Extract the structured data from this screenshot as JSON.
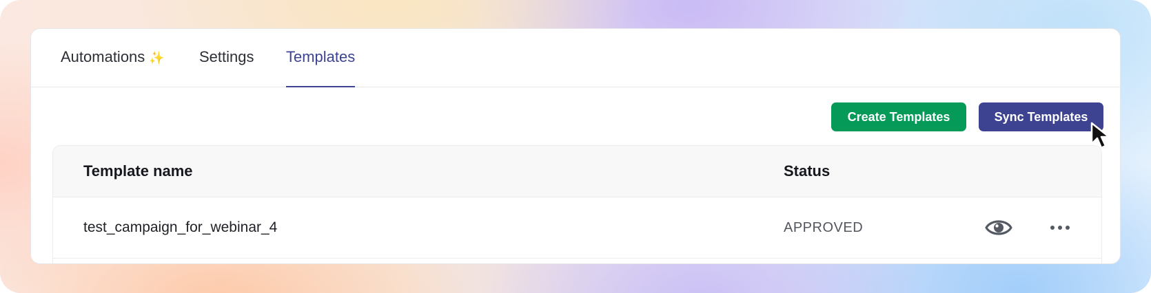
{
  "tabs": [
    {
      "label": "Automations",
      "icon": "sparkles-icon",
      "icon_glyph": "✨"
    },
    {
      "label": "Settings"
    },
    {
      "label": "Templates",
      "active": true
    }
  ],
  "toolbar": {
    "create_label": "Create Templates",
    "sync_label": "Sync Templates"
  },
  "table": {
    "columns": [
      "Template name",
      "Status"
    ],
    "rows": [
      {
        "name": "test_campaign_for_webinar_4",
        "status": "APPROVED",
        "actions": [
          "eye-icon",
          "more-options-icon"
        ]
      }
    ]
  },
  "colors": {
    "accent": "#3d4391",
    "create_button": "#069a58",
    "sync_button": "#3d4391"
  }
}
